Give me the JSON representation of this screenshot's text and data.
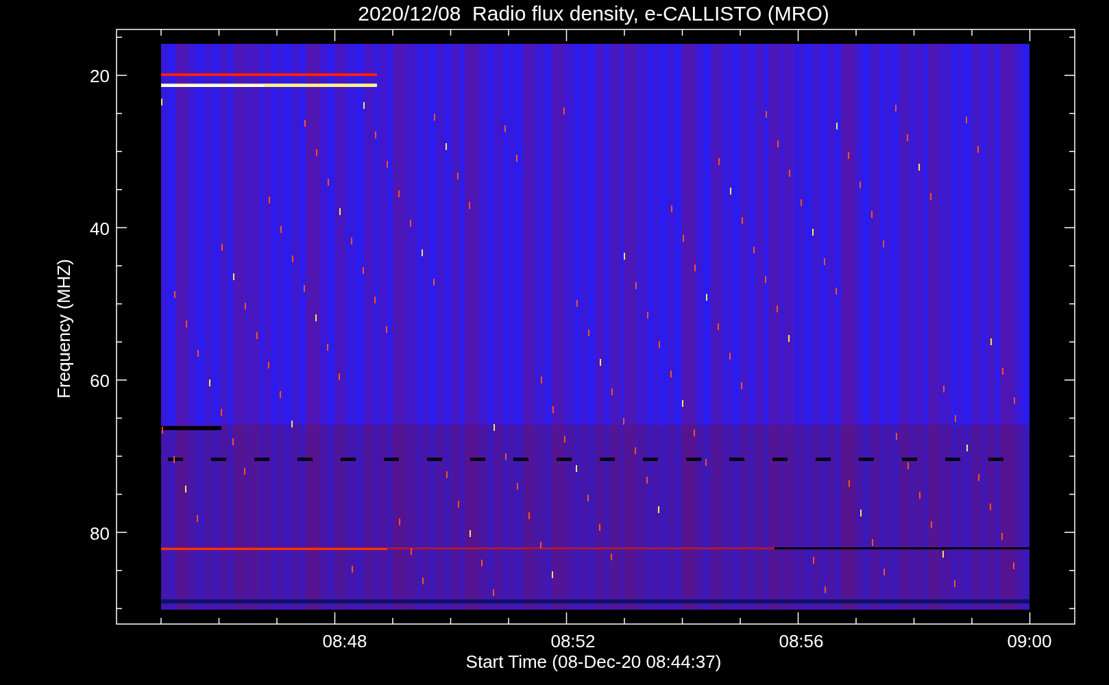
{
  "title": "2020/12/08  Radio flux density, e-CALLISTO (MRO)",
  "y_axis": {
    "label": "Frequency (MHZ)",
    "ticks": [
      "20",
      "40",
      "60",
      "80"
    ]
  },
  "x_axis": {
    "label": "Start Time (08-Dec-20 08:44:37)",
    "ticks": [
      "08:48",
      "08:52",
      "08:56",
      "09:00"
    ]
  }
}
